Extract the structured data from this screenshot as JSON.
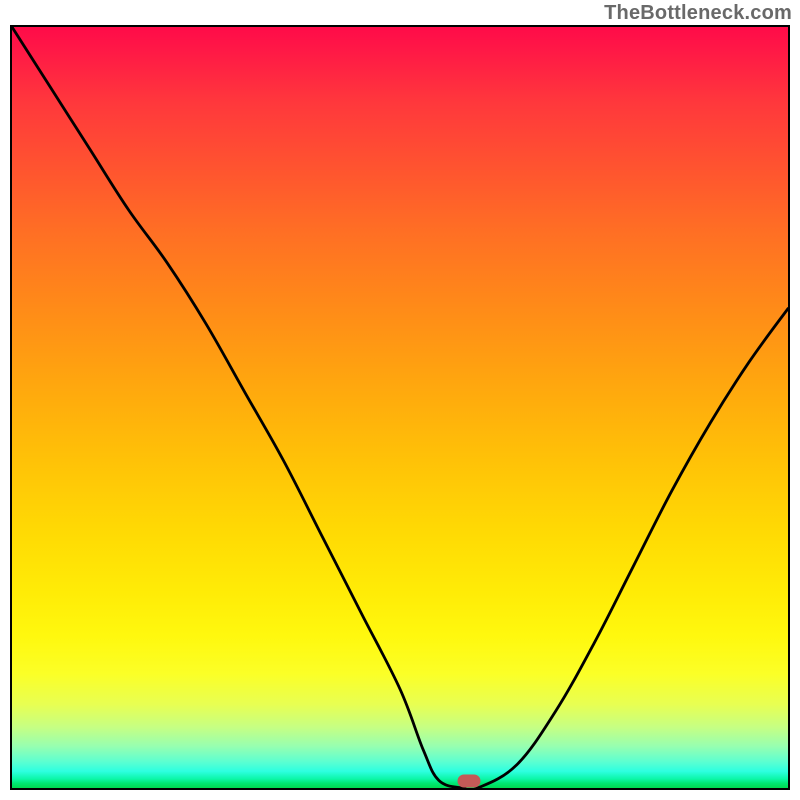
{
  "watermark": "TheBottleneck.com",
  "colors": {
    "gradient_top": "#ff0b49",
    "gradient_bottom": "#00da50",
    "curve": "#000000",
    "marker": "#c35a57",
    "border": "#000000"
  },
  "chart_data": {
    "type": "line",
    "title": "",
    "xlabel": "",
    "ylabel": "",
    "xlim": [
      0,
      100
    ],
    "ylim": [
      0,
      100
    ],
    "x": [
      0,
      5,
      10,
      15,
      20,
      25,
      30,
      35,
      40,
      45,
      50,
      53,
      55,
      58,
      60,
      65,
      70,
      75,
      80,
      85,
      90,
      95,
      100
    ],
    "values": [
      100,
      92,
      84,
      76,
      69,
      61,
      52,
      43,
      33,
      23,
      13,
      5,
      1,
      0,
      0,
      3,
      10,
      19,
      29,
      39,
      48,
      56,
      63
    ],
    "marker": {
      "x": 59,
      "y": 0
    },
    "note": "Values are relative heights of the black curve measured against the plot area (0 = bottom edge, 100 = top edge). X is normalized horizontal position across the plot box."
  }
}
